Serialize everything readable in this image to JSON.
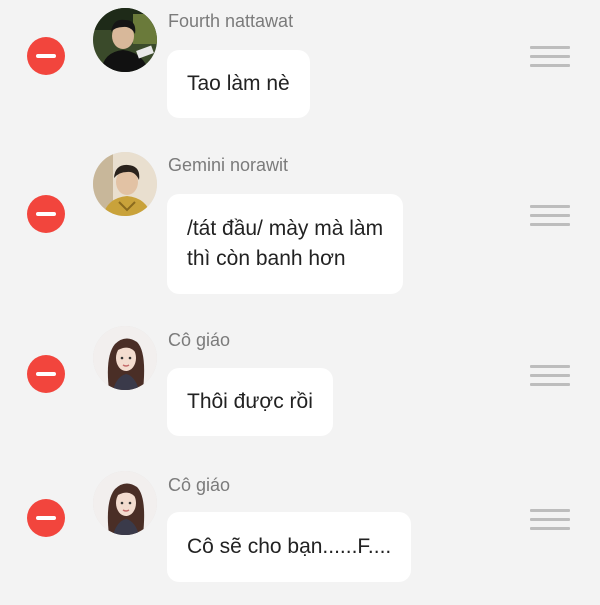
{
  "messages": [
    {
      "name": "Fourth nattawat",
      "lines": [
        "Tao làm nè"
      ]
    },
    {
      "name": "Gemini norawit",
      "lines": [
        "/tát đầu/ mày mà làm",
        "thì còn banh hơn"
      ]
    },
    {
      "name": "Cô giáo",
      "lines": [
        "Thôi được rồi"
      ]
    },
    {
      "name": "Cô giáo",
      "lines": [
        "Cô sẽ cho bạn......F...."
      ]
    }
  ],
  "colors": {
    "background": "#f3f3f3",
    "remove_button": "#f2453d",
    "bubble": "#ffffff",
    "name_text": "#7b7b7b",
    "message_text": "#222222",
    "drag_handle": "#bdbdbd"
  },
  "icons": {
    "remove": "minus-circle-icon",
    "reorder": "drag-handle-icon"
  }
}
